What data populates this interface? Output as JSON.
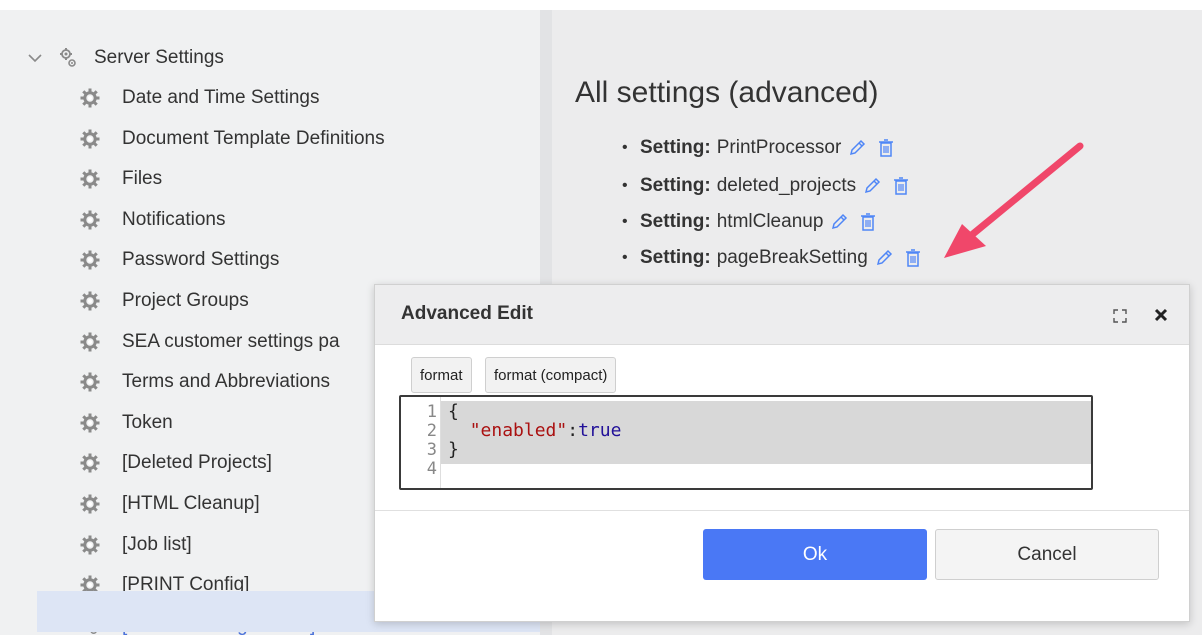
{
  "colors": {
    "accent": "#4a78f5",
    "selected_text": "#4b72d9",
    "selected_bg": "#dde5f5",
    "arrow": "#f0476a",
    "icon_blue": "#4f86f7"
  },
  "sidebar": {
    "root": {
      "label": "Server Settings",
      "icon": "gears-icon",
      "expanded": true
    },
    "items": [
      {
        "label": "Date and Time Settings",
        "icon": "gear-icon"
      },
      {
        "label": "Document Template Definitions",
        "icon": "gear-icon"
      },
      {
        "label": "Files",
        "icon": "gear-icon"
      },
      {
        "label": "Notifications",
        "icon": "gear-icon"
      },
      {
        "label": "Password Settings",
        "icon": "gear-icon"
      },
      {
        "label": "Project Groups",
        "icon": "gear-icon"
      },
      {
        "label": "SEA customer settings pa",
        "icon": "gear-icon"
      },
      {
        "label": "Terms and Abbreviations",
        "icon": "gear-icon"
      },
      {
        "label": "Token",
        "icon": "gear-icon"
      },
      {
        "label": "[Deleted Projects]",
        "icon": "gear-icon"
      },
      {
        "label": "[HTML Cleanup]",
        "icon": "gear-icon"
      },
      {
        "label": "[Job list]",
        "icon": "gear-icon"
      },
      {
        "label": "[PRINT Config]",
        "icon": "gear-icon"
      },
      {
        "label": "[Server Settings editor]",
        "icon": "gears-icon",
        "selected": true
      }
    ]
  },
  "main": {
    "title": "All settings (advanced)",
    "settings": [
      {
        "key": "Setting:",
        "name": "PrintProcessor"
      },
      {
        "key": "Setting:",
        "name": "deleted_projects"
      },
      {
        "key": "Setting:",
        "name": "htmlCleanup"
      },
      {
        "key": "Setting:",
        "name": "pageBreakSetting"
      }
    ]
  },
  "dialog": {
    "title": "Advanced Edit",
    "format_label": "format",
    "format_compact_label": "format (compact)",
    "code": {
      "line_numbers": [
        "1",
        "2",
        "3",
        "4"
      ],
      "open_brace": "{",
      "key": "\"enabled\"",
      "colon": ":",
      "value": "true",
      "close_brace": "}"
    },
    "ok_label": "Ok",
    "cancel_label": "Cancel"
  }
}
